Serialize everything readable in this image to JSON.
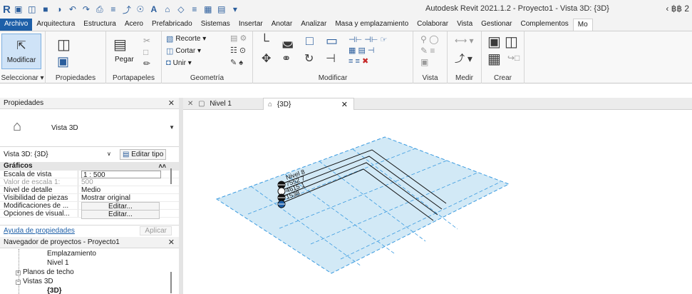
{
  "app": {
    "title": "Autodesk Revit 2021.1.2 - Proyecto1 - Vista 3D: {3D}",
    "right_icons": "‹ ฿฿ 2"
  },
  "menu": {
    "file": "Archivo",
    "tabs": [
      "Arquitectura",
      "Estructura",
      "Acero",
      "Prefabricado",
      "Sistemas",
      "Insertar",
      "Anotar",
      "Analizar",
      "Masa y emplazamiento",
      "Colaborar",
      "Vista",
      "Gestionar",
      "Complementos",
      "Mo"
    ]
  },
  "ribbon": {
    "modify": "Modificar",
    "seleccionar": "Seleccionar ▾",
    "propiedades": "Propiedades",
    "pegar": "Pegar",
    "portapapeles": "Portapapeles",
    "recorte": "Recorte ▾",
    "cortar": "Cortar ▾",
    "unir": "Unir ▾",
    "geometria": "Geometría",
    "modificar": "Modificar",
    "vista": "Vista",
    "medir": "Medir",
    "crear": "Crear"
  },
  "properties": {
    "header": "Propiedades",
    "type_name": "Vista 3D",
    "instance": "Vista 3D: {3D}",
    "edit_type": "Editar tipo",
    "section": "Gráficos",
    "rows": [
      {
        "k": "Escala de vista",
        "v": "1 : 500"
      },
      {
        "k": "Valor de escala   1:",
        "v": "500"
      },
      {
        "k": "Nivel de detalle",
        "v": "Medio"
      },
      {
        "k": "Visibilidad de piezas",
        "v": "Mostrar original"
      },
      {
        "k": "Modificaciones de ...",
        "v": "Editar..."
      },
      {
        "k": "Opciones de visual...",
        "v": "Editar..."
      }
    ],
    "help_link": "Ayuda de propiedades",
    "apply": "Aplicar"
  },
  "browser": {
    "header": "Navegador de proyectos - Proyecto1",
    "items": [
      "Emplazamiento",
      "Nivel 1",
      "Planos de techo",
      "Vistas 3D",
      "{3D}"
    ]
  },
  "view_tabs": [
    {
      "label": "Nivel 1"
    },
    {
      "label": "{3D}"
    }
  ],
  "levels": [
    "Nivel 8",
    "7552 7",
    "4615 1",
    "1538"
  ]
}
